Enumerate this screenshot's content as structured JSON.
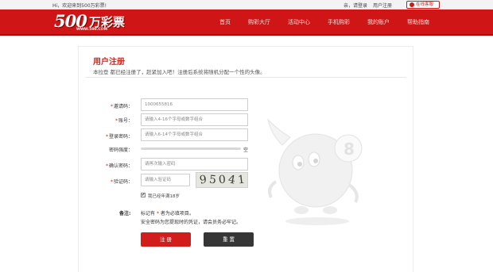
{
  "topbar": {
    "welcome": "Hi，欢迎来到500万彩票!",
    "login_link": "亲，请登录",
    "register_link": "用户注册",
    "service_button": "在线客服"
  },
  "header": {
    "logo_number": "500",
    "logo_text": "万彩票",
    "logo_url": "WWW.500.COM",
    "nav": [
      "首页",
      "购彩大厅",
      "活动中心",
      "手机购彩",
      "我的账户",
      "帮助指南"
    ]
  },
  "form": {
    "title": "用户注册",
    "description": "本拉登 都已经注册了，赶紧加入吧！注册后系统将随机分配一个性的头像。",
    "invite_label": "邀请码：",
    "invite_value": "1000655816",
    "account_label": "账号：",
    "account_placeholder": "请输入4-16个字母或数字组合",
    "password_label": "登录密码：",
    "password_placeholder": "请输入6-14个字母或数字组合",
    "strength_label": "密码强度：",
    "strength_value": "空",
    "confirm_label": "确认密码：",
    "confirm_placeholder": "请再次输入密码",
    "captcha_label": "验证码：",
    "captcha_placeholder": "请输入验证码",
    "captcha_chars": [
      "9",
      "5",
      "0",
      "4",
      "1"
    ],
    "required_mark": "*",
    "agree_text": "我已经年满18岁",
    "agree_checked": true,
    "note_label": "备注:",
    "note_line1_prefix": "标记有",
    "note_line1_suffix": "者为必填项目。",
    "note_line2": "安全密码为您提现时的凭证，请会员务必牢记。",
    "submit_label": "注 册",
    "reset_label": "重 置"
  },
  "colors": {
    "brand_red": "#cf1515",
    "button_red": "#d21d1d",
    "button_dark": "#363636",
    "title_red": "#d0231c"
  }
}
